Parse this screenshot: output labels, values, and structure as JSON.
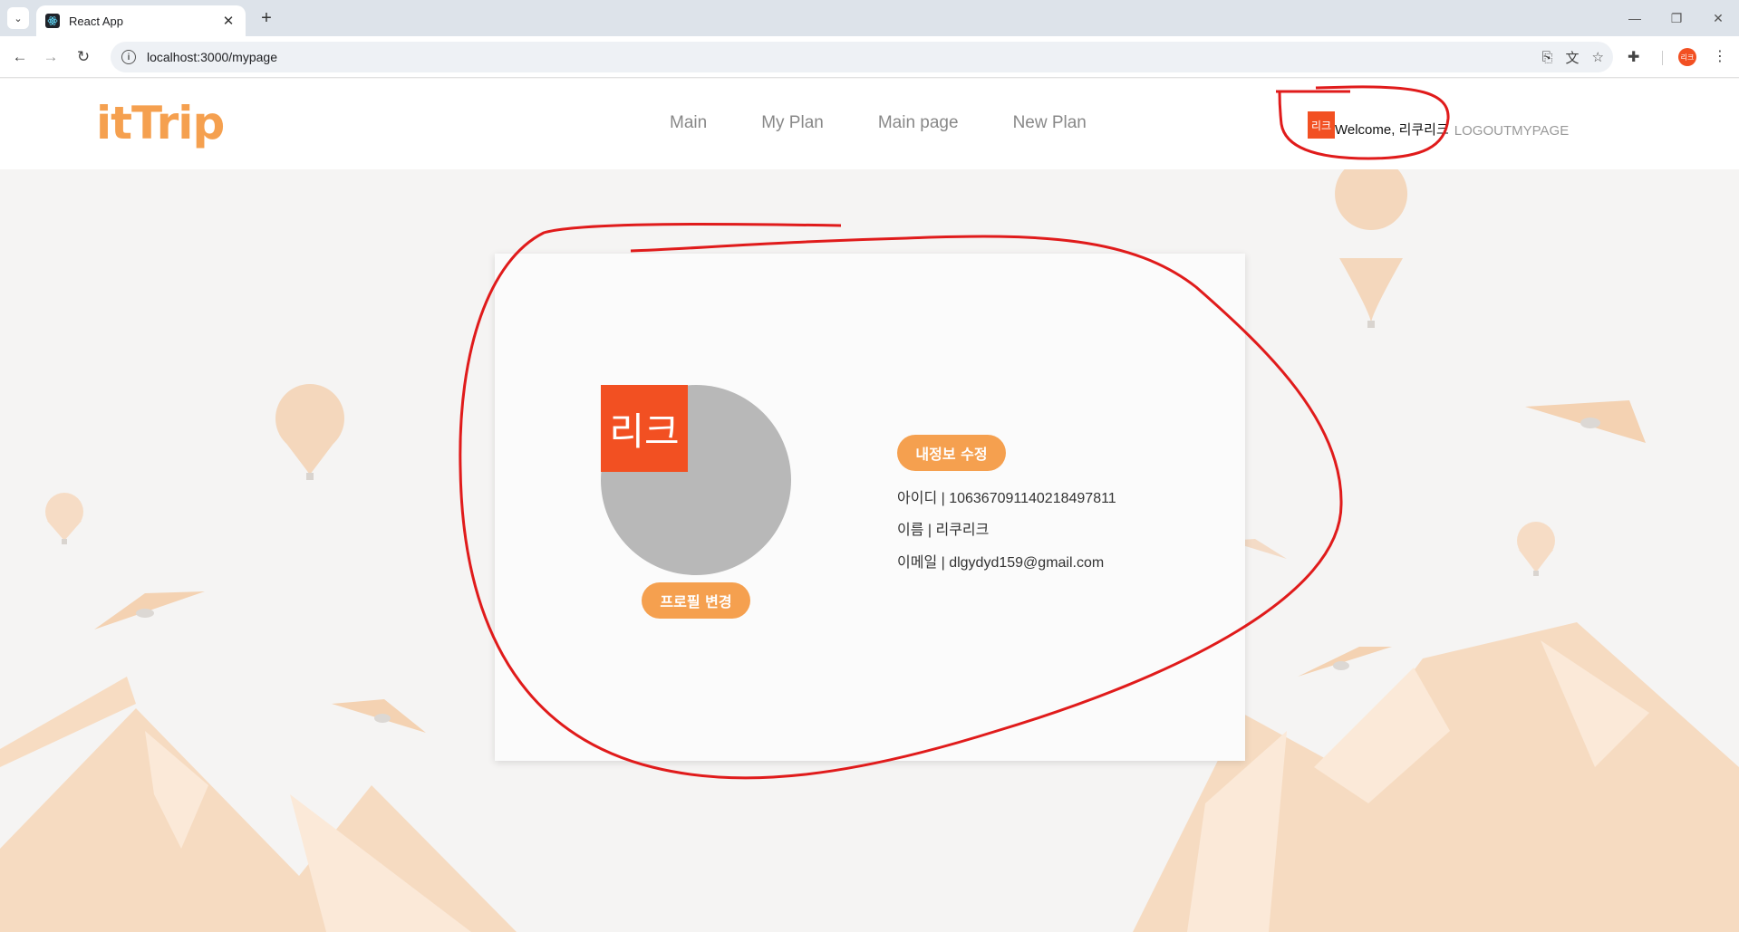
{
  "browser": {
    "tab_title": "React App",
    "url": "localhost:3000/mypage",
    "profile_initials": "리크"
  },
  "header": {
    "logo": "itTrip",
    "nav": [
      "Main",
      "My Plan",
      "Main page",
      "New Plan"
    ],
    "avatar_initials": "리크",
    "welcome": "Welcome, 리쿠리크",
    "logout": "LOGOUT",
    "mypage": "MYPAGE"
  },
  "profile": {
    "avatar_initials": "리크",
    "change_profile_button": "프로필 변경",
    "edit_info_button": "내정보 수정",
    "id_line": "아이디 | 106367091140218497811",
    "name_line": "이름 | 리쿠리크",
    "email_line": "이메일 | dlgydyd159@gmail.com"
  },
  "colors": {
    "accent": "#f5a04f",
    "avatar": "#f25022",
    "annotation": "#e01b1b"
  }
}
